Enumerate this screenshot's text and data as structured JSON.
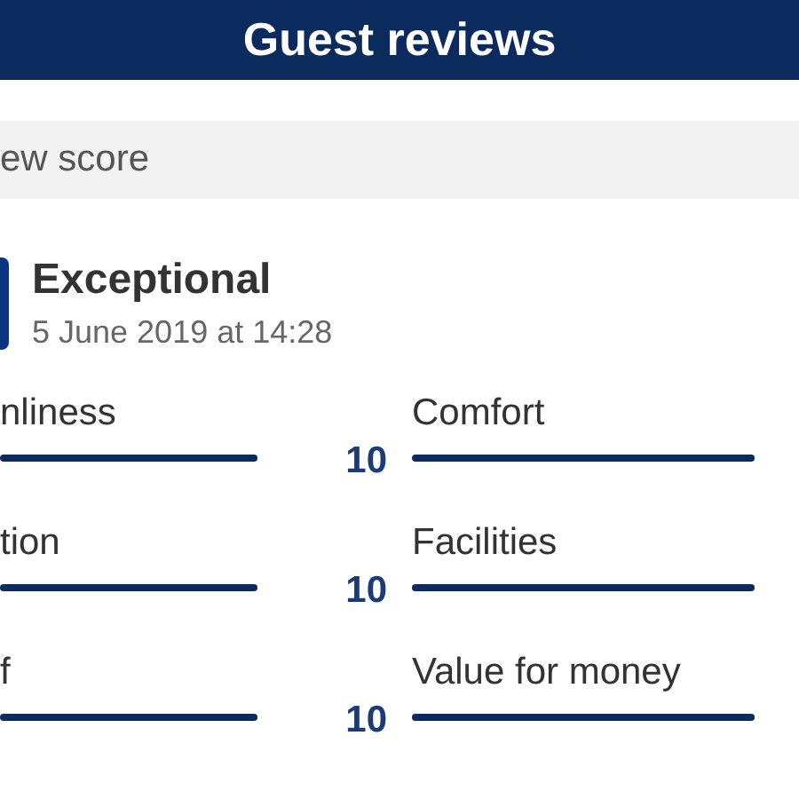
{
  "header": {
    "title": "Guest reviews"
  },
  "section": {
    "title": "ew score"
  },
  "review": {
    "rating_label": "Exceptional",
    "date": "5 June 2019 at 14:28"
  },
  "categories": [
    {
      "label": "nliness",
      "level": 1,
      "score": "10"
    },
    {
      "label": "Comfort",
      "level": 1
    },
    {
      "label": "tion",
      "level": 1,
      "score": "10"
    },
    {
      "label": "Facilities",
      "level": 1
    },
    {
      "label": "f",
      "level": 1,
      "score": "10"
    },
    {
      "label": "Value for money",
      "level": 1
    }
  ]
}
